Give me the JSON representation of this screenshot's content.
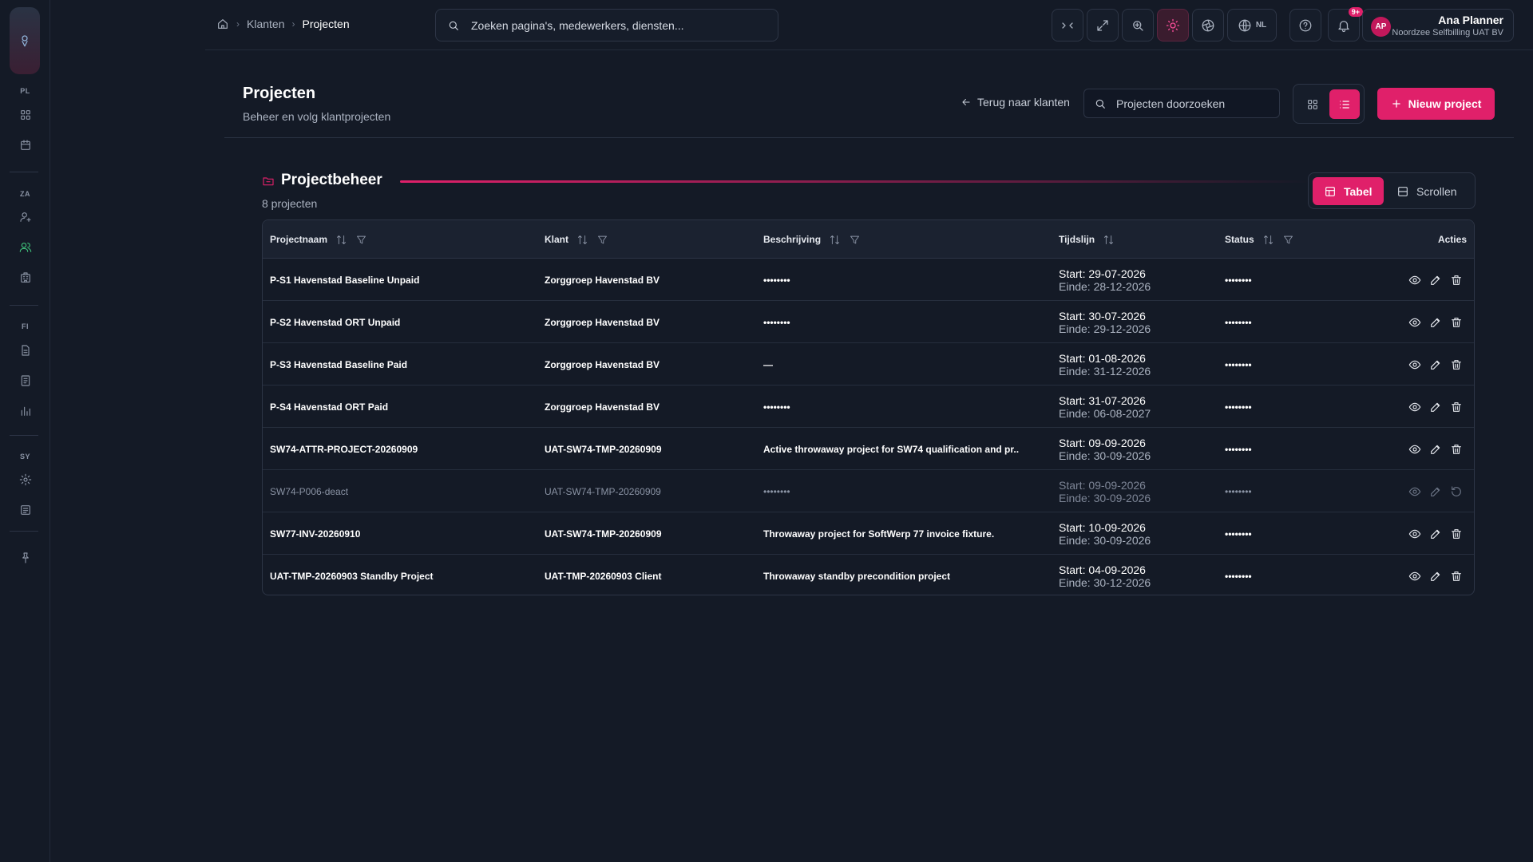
{
  "sidebar": {
    "sections": [
      {
        "label": "PL",
        "items": [
          {
            "name": "dashboard-icon"
          },
          {
            "name": "calendar-icon"
          }
        ]
      },
      {
        "label": "ZA",
        "items": [
          {
            "name": "user-icon"
          },
          {
            "name": "users-icon",
            "active": true
          },
          {
            "name": "building-icon"
          }
        ]
      },
      {
        "label": "FI",
        "items": [
          {
            "name": "document-icon"
          },
          {
            "name": "invoice-icon"
          },
          {
            "name": "chart-icon"
          }
        ]
      },
      {
        "label": "SY",
        "items": [
          {
            "name": "gear-icon"
          },
          {
            "name": "log-icon"
          }
        ]
      }
    ]
  },
  "breadcrumb": {
    "items": [
      "Klanten",
      "Projecten"
    ]
  },
  "search": {
    "placeholder": "Zoeken pagina's, medewerkers, diensten..."
  },
  "topbar": {
    "lang": "NL",
    "notifications": "9+"
  },
  "user": {
    "initials": "AP",
    "name": "Ana Planner",
    "org": "Noordzee Selfbilling UAT BV"
  },
  "page": {
    "title": "Projecten",
    "subtitle": "Beheer en volg klantprojecten",
    "back_label": "Terug naar klanten",
    "search_placeholder": "Projecten doorzoeken",
    "new_label": "Nieuw project"
  },
  "section": {
    "title": "Projectbeheer",
    "count": "8 projecten",
    "mode_table": "Tabel",
    "mode_scroll": "Scrollen"
  },
  "table": {
    "columns": {
      "name": "Projectnaam",
      "client": "Klant",
      "desc": "Beschrijving",
      "timeline": "Tijdslijn",
      "status": "Status",
      "actions": "Acties"
    },
    "rows": [
      {
        "name": "P-S1 Havenstad Baseline Unpaid",
        "client": "Zorggroep Havenstad BV",
        "desc": "••••••••",
        "start": "Start: 29-07-2026",
        "end": "Einde: 28-12-2026",
        "status": "••••••••"
      },
      {
        "name": "P-S2 Havenstad ORT Unpaid",
        "client": "Zorggroep Havenstad BV",
        "desc": "••••••••",
        "start": "Start: 30-07-2026",
        "end": "Einde: 29-12-2026",
        "status": "••••••••"
      },
      {
        "name": "P-S3 Havenstad Baseline Paid",
        "client": "Zorggroep Havenstad BV",
        "desc": "—",
        "start": "Start: 01-08-2026",
        "end": "Einde: 31-12-2026",
        "status": "••••••••"
      },
      {
        "name": "P-S4 Havenstad ORT Paid",
        "client": "Zorggroep Havenstad BV",
        "desc": "••••••••",
        "start": "Start: 31-07-2026",
        "end": "Einde: 06-08-2027",
        "status": "••••••••"
      },
      {
        "name": "SW74-ATTR-PROJECT-20260909",
        "client": "UAT-SW74-TMP-20260909",
        "desc": "Active throwaway project for SW74 qualification and pr...",
        "start": "Start: 09-09-2026",
        "end": "Einde: 30-09-2026",
        "status": "••••••••"
      },
      {
        "name": "SW74-P006-deact",
        "client": "UAT-SW74-TMP-20260909",
        "desc": "••••••••",
        "start": "Start: 09-09-2026",
        "end": "Einde: 30-09-2026",
        "status": "••••••••",
        "inactive": true
      },
      {
        "name": "SW77-INV-20260910",
        "client": "UAT-SW74-TMP-20260909",
        "desc": "Throwaway project for SoftWerp 77 invoice fixture.",
        "start": "Start: 10-09-2026",
        "end": "Einde: 30-09-2026",
        "status": "••••••••"
      },
      {
        "name": "UAT-TMP-20260903 Standby Project",
        "client": "UAT-TMP-20260903 Client",
        "desc": "Throwaway standby precondition project",
        "start": "Start: 04-09-2026",
        "end": "Einde: 30-12-2026",
        "status": "••••••••"
      }
    ]
  }
}
